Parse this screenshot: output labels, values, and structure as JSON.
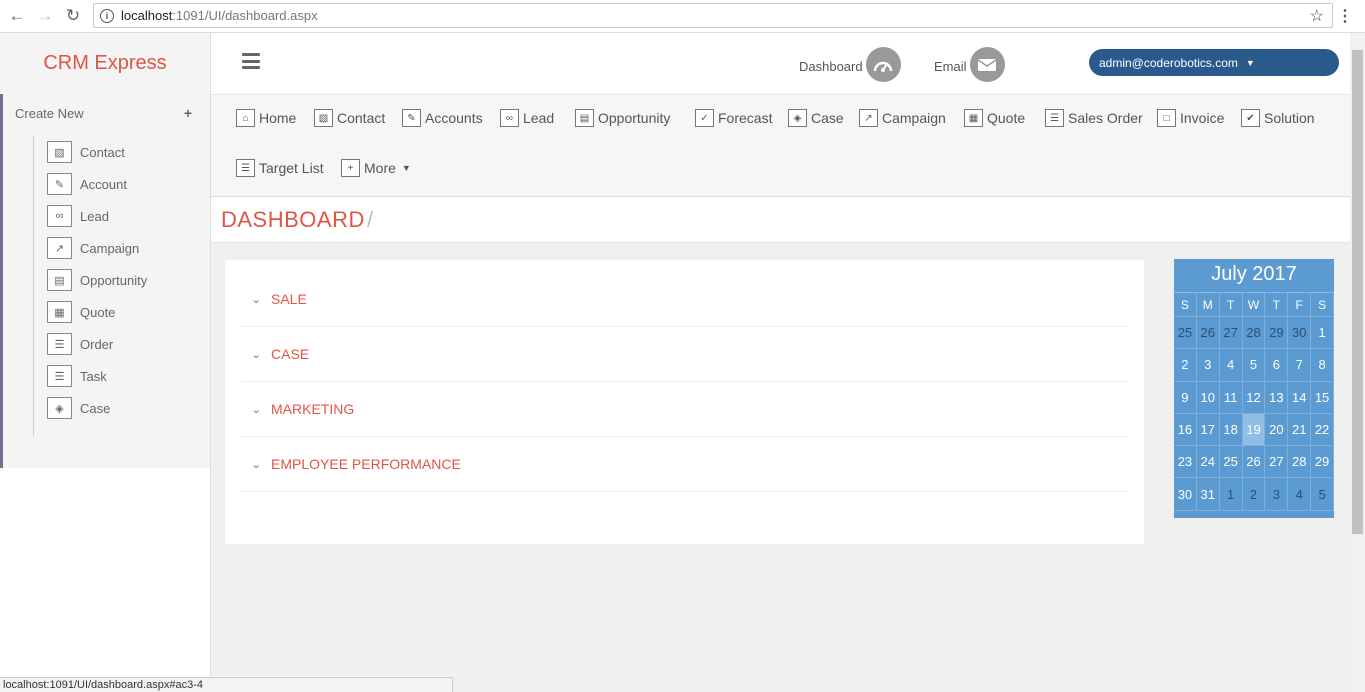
{
  "browser": {
    "url_host": "localhost",
    "url_path": ":1091/UI/dashboard.aspx",
    "status_url": "localhost:1091/UI/dashboard.aspx#ac3-4"
  },
  "brand": "CRM Express",
  "sidebar": {
    "create_new_label": "Create New",
    "items": [
      {
        "label": "Contact",
        "icon": "contact-card-icon"
      },
      {
        "label": "Account",
        "icon": "edit-icon"
      },
      {
        "label": "Lead",
        "icon": "handshake-icon"
      },
      {
        "label": "Campaign",
        "icon": "line-chart-icon"
      },
      {
        "label": "Opportunity",
        "icon": "id-card-icon"
      },
      {
        "label": "Quote",
        "icon": "calculator-icon"
      },
      {
        "label": "Order",
        "icon": "list-icon"
      },
      {
        "label": "Task",
        "icon": "tasks-icon"
      },
      {
        "label": "Case",
        "icon": "tag-icon"
      }
    ]
  },
  "header": {
    "dashboard_label": "Dashboard",
    "email_label": "Email",
    "user_email": "admin@coderobotics.com"
  },
  "menu": {
    "items": [
      {
        "label": "Home",
        "icon": "home-icon"
      },
      {
        "label": "Contact",
        "icon": "contact-card-icon"
      },
      {
        "label": "Accounts",
        "icon": "edit-icon"
      },
      {
        "label": "Lead",
        "icon": "handshake-icon"
      },
      {
        "label": "Opportunity",
        "icon": "id-card-icon"
      },
      {
        "label": "Forecast",
        "icon": "calendar-check-icon"
      },
      {
        "label": "Case",
        "icon": "tag-icon"
      },
      {
        "label": "Campaign",
        "icon": "line-chart-icon"
      },
      {
        "label": "Quote",
        "icon": "calculator-icon"
      },
      {
        "label": "Sales Order",
        "icon": "list-icon"
      },
      {
        "label": "Invoice",
        "icon": "file-icon"
      },
      {
        "label": "Solution",
        "icon": "checkbox-icon"
      },
      {
        "label": "Target List",
        "icon": "list-icon"
      },
      {
        "label": "More",
        "icon": "plus-square-icon"
      }
    ]
  },
  "page_title": "DASHBOARD",
  "breadcrumb_sep": "/",
  "accordion": [
    {
      "label": "SALE"
    },
    {
      "label": "CASE"
    },
    {
      "label": "MARKETING"
    },
    {
      "label": "EMPLOYEE PERFORMANCE"
    }
  ],
  "calendar": {
    "title": "July 2017",
    "weekdays": [
      "S",
      "M",
      "T",
      "W",
      "T",
      "F",
      "S"
    ],
    "days": [
      [
        "25",
        "26",
        "27",
        "28",
        "29",
        "30",
        "1"
      ],
      [
        "2",
        "3",
        "4",
        "5",
        "6",
        "7",
        "8"
      ],
      [
        "9",
        "10",
        "11",
        "12",
        "13",
        "14",
        "15"
      ],
      [
        "16",
        "17",
        "18",
        "19",
        "20",
        "21",
        "22"
      ],
      [
        "23",
        "24",
        "25",
        "26",
        "27",
        "28",
        "29"
      ],
      [
        "30",
        "31",
        "1",
        "2",
        "3",
        "4",
        "5"
      ]
    ],
    "today": "19",
    "colors": {
      "background": "#5b9bd1",
      "today": "#8fbfe6",
      "other_month": "#2b4f73"
    }
  },
  "colors": {
    "accent": "#e05545",
    "user_button": "#2a5a8c",
    "sidebar_border": "#6d6f93"
  }
}
